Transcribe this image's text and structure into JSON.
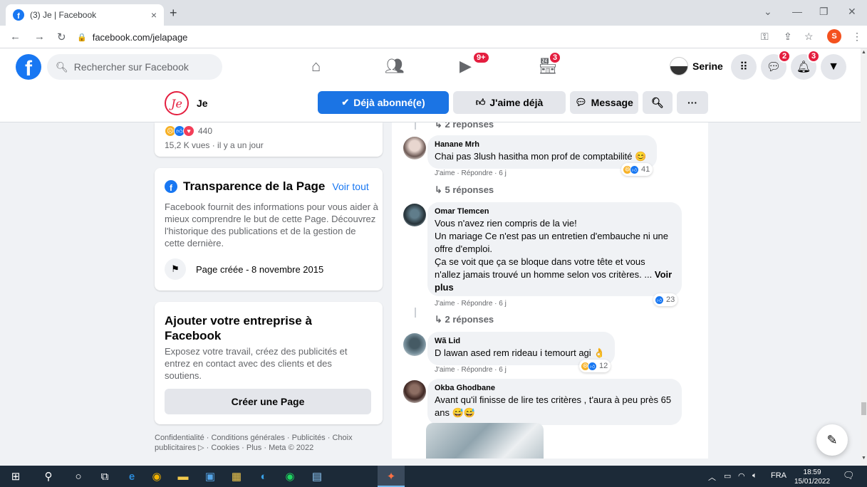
{
  "browser": {
    "tab_title": "(3) Je | Facebook",
    "tab_close": "×",
    "new_tab": "+",
    "url": "facebook.com/jelapage"
  },
  "fb": {
    "search_placeholder": "Rechercher sur Facebook",
    "watch_badge": "9+",
    "marketplace_badge": "3",
    "profile_name": "Serine",
    "messenger_badge": "2",
    "notif_badge": "3",
    "account_initial": "S"
  },
  "page": {
    "name": "Je",
    "logo_text": "Je",
    "subscribed_label": "Déjà abonné(e)",
    "like_label": "J'aime déjà",
    "message_label": "Message",
    "more_label": "···"
  },
  "left": {
    "reaction_count": "440",
    "views": "15,2 K vues · il y a un jour",
    "transparency": {
      "title": "Transparence de la Page",
      "see_all": "Voir tout",
      "description": "Facebook fournit des informations pour vous aider à mieux comprendre le but de cette Page. Découvrez l'historique des publications et de la gestion de cette dernière.",
      "created": "Page créée - 8 novembre 2015"
    },
    "business": {
      "title": "Ajouter votre entreprise à Facebook",
      "description": "Exposez votre travail, créez des publicités et entrez en contact avec des clients et des soutiens.",
      "button": "Créer une Page"
    },
    "footer": "Confidentialité · Conditions générales · Publicités · Choix publicitaires ▷ · Cookies · Plus · Meta © 2022"
  },
  "comments": {
    "top_replies": "↳ 2 réponses",
    "items": [
      {
        "name": "Hanane Mrh",
        "text": "Chai pas 3lush hasitha mon prof de comptabilité 😊",
        "actions": "J'aime · Répondre · 6 j",
        "reactions": "41",
        "replies": "↳ 5 réponses"
      },
      {
        "name": "Omar Tlemcen",
        "text_lines": [
          "Vous n'avez rien compris de la vie!",
          "Un mariage Ce n'est pas un entretien d'embauche ni une offre d'emploi.",
          "Ça se voit que ça se bloque dans votre tête et vous n'allez jamais trouvé un homme selon vos critères. ..."
        ],
        "see_more": "Voir plus",
        "actions": "J'aime · Répondre · 6 j",
        "reactions": "23",
        "replies": "↳ 2 réponses"
      },
      {
        "name": "Wã Lid",
        "text": "D lawan ased rem rideau i temourt agi 👌",
        "actions": "J'aime · Répondre · 6 j",
        "reactions": "12"
      },
      {
        "name": "Okba Ghodbane",
        "text": "Avant qu'il finisse de lire tes critères , t'aura à peu près 65 ans 😅😅"
      }
    ]
  },
  "taskbar": {
    "lang": "FRA",
    "time": "18:59",
    "date": "15/01/2022"
  }
}
